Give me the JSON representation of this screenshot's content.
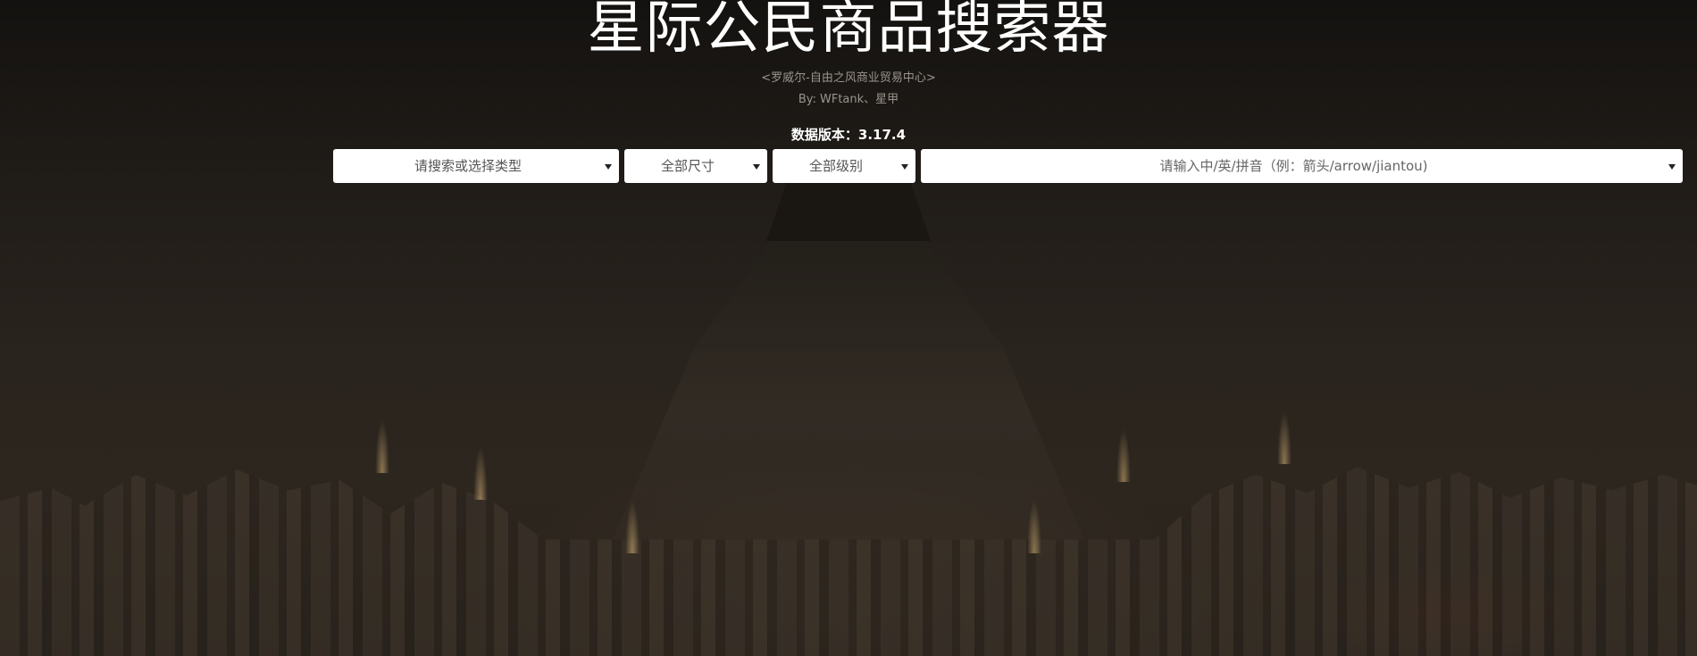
{
  "header": {
    "title": "星际公民商品搜索器",
    "subtitle": "<罗威尔-自由之风商业贸易中心>",
    "author": "By: WFtank、星甲",
    "version_label": "数据版本：",
    "version_value": "3.17.4"
  },
  "filters": {
    "type_select": {
      "placeholder": "请搜索或选择类型",
      "icon": "chevron-down-icon"
    },
    "size_select": {
      "selected": "全部尺寸",
      "icon": "chevron-down-icon"
    },
    "level_select": {
      "selected": "全部级别",
      "icon": "chevron-down-icon"
    },
    "search_select": {
      "placeholder": "请输入中/英/拼音（例：箭头/arrow/jiantou)",
      "icon": "chevron-down-icon"
    }
  },
  "colors": {
    "background": "#231d18",
    "title": "#ffffff",
    "subtext": "#9a948c",
    "select_bg": "#ffffff",
    "select_text": "#555555"
  }
}
